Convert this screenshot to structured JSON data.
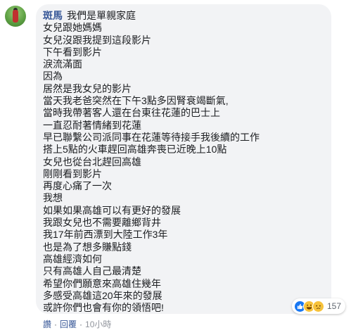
{
  "comment": {
    "author": "斑馬",
    "lines": [
      "我們是單親家庭",
      "女兒跟她媽媽",
      "女兒沒跟我提到這段影片",
      "下午看到影片",
      "淚流滿面",
      "因為",
      "居然是我女兒的影片",
      "當天我老爸突然在下午3點多因腎衰竭斷氣,",
      "當時我帶著客人還在台東往花蓮的巴士上",
      "一直忍耐著情緒到花蓮",
      "早已聯繫公司派同事在花蓮等待接手我後續的工作",
      "搭上5點的火車趕回高雄奔喪已近晚上10點",
      "女兒也從台北趕回高雄",
      "剛剛看到影片",
      "再度心痛了一次",
      "我想",
      "如果如果高雄可以有更好的發展",
      "我跟女兒也不需要離鄉背井",
      "我17年前西漂到大陸工作3年",
      "也是為了想多賺點錢",
      "高雄經濟如何",
      "只有高雄人自己最清楚",
      "希望你們願意來高雄住幾年",
      "多感受高雄這20年來的發展",
      "或許你們也會有你的領悟吧!"
    ]
  },
  "reactions": {
    "icons": [
      "like-icon",
      "haha-icon",
      "sad-icon"
    ],
    "count": "157"
  },
  "actions": {
    "like": "讚",
    "reply": "回覆",
    "separator": "·",
    "time": "10小時"
  }
}
